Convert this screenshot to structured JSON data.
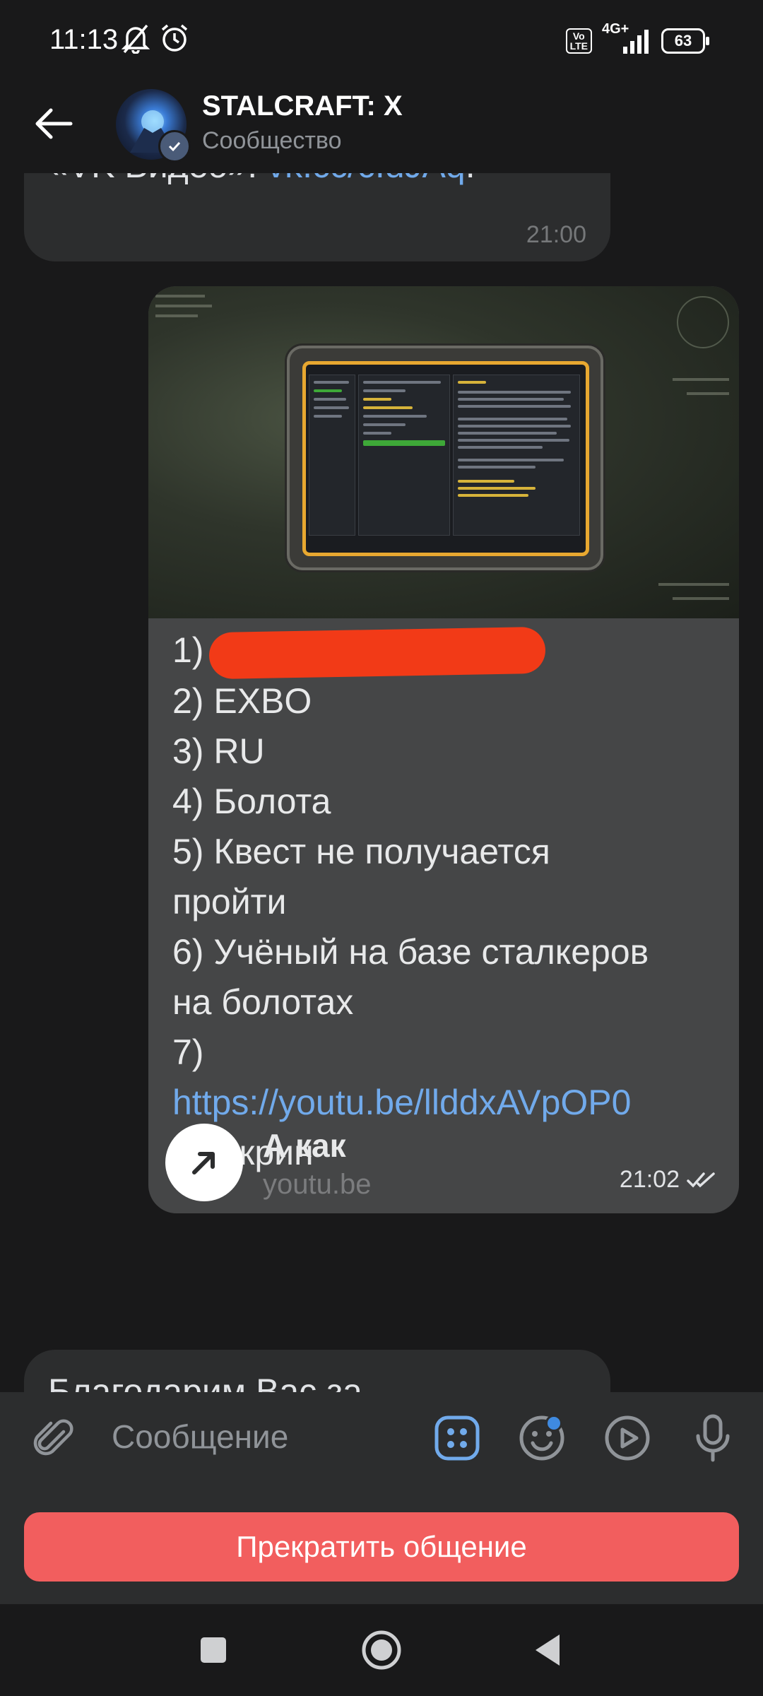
{
  "status_bar": {
    "time": "11:13",
    "network_label": "4G+",
    "volte_label": "Vo\nLTE",
    "battery": "63"
  },
  "header": {
    "title": "STALCRAFT: X",
    "subtitle": "Сообщество"
  },
  "messages": [
    {
      "text_prefix": "«VK Видео»: ",
      "link": "vk.cc/cIdJAq",
      "text_suffix": ".",
      "time": "21:00"
    },
    {
      "lines": {
        "l1": "1)",
        "l2": "2) EXBO",
        "l3": "3) RU",
        "l4": "4) Болота",
        "l5a": "5) Квест не получается",
        "l5b": "пройти",
        "l6a": "6) Учёный на базе сталкеров",
        "l6b": "на болотах",
        "l7": "7)",
        "l7_link": "https://youtu.be/llddxAVpOP0",
        "l8": "8) Скрин"
      },
      "preview": {
        "title": "А как",
        "domain": "youtu.be"
      },
      "time": "21:02"
    },
    {
      "text": "Благодарим Вас за"
    }
  ],
  "composer": {
    "placeholder": "Сообщение"
  },
  "end_chat_button": "Прекратить общение",
  "colors": {
    "accent_link": "#71aaeb",
    "end_button": "#f25e5e",
    "redaction": "#f23a17"
  }
}
